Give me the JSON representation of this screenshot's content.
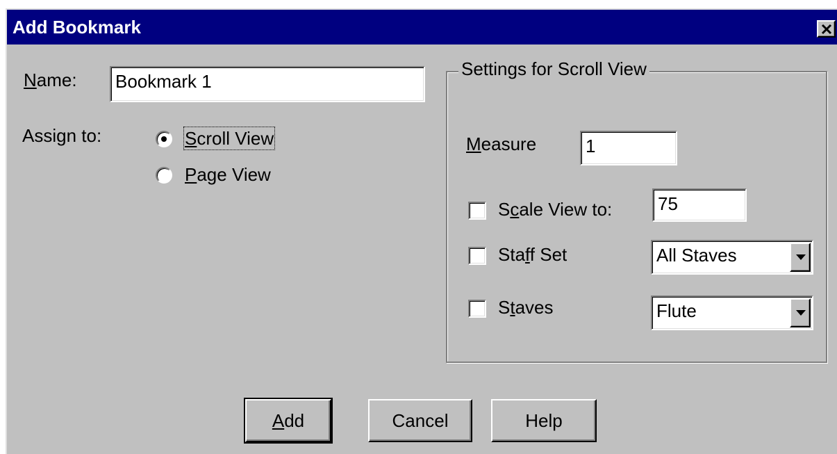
{
  "dialog": {
    "title": "Add Bookmark",
    "close_glyph": "✕"
  },
  "name": {
    "label_accel": "N",
    "label_rest": "ame:",
    "value": "Bookmark 1"
  },
  "assign": {
    "label": "Assign to:",
    "options": [
      {
        "accel": "S",
        "rest": "croll View",
        "selected": true
      },
      {
        "accel": "P",
        "rest": "age View",
        "selected": false
      }
    ]
  },
  "settings": {
    "group_title": "Settings for Scroll View",
    "measure": {
      "label_accel": "M",
      "label_rest": "easure",
      "value": "1"
    },
    "scale": {
      "label_pre": "S",
      "label_accel": "c",
      "label_rest": "ale View to:",
      "value": "75",
      "checked": false
    },
    "staff_set": {
      "label_pre": "Sta",
      "label_accel": "f",
      "label_rest": "f Set",
      "selected": "All Staves",
      "checked": false
    },
    "staves": {
      "label_pre": "S",
      "label_accel": "t",
      "label_rest": "aves",
      "selected": "Flute",
      "checked": false
    }
  },
  "buttons": {
    "add_accel": "A",
    "add_rest": "dd",
    "cancel": "Cancel",
    "help": "Help"
  },
  "colors": {
    "titlebar": "#000080",
    "face": "#c0c0c0"
  }
}
